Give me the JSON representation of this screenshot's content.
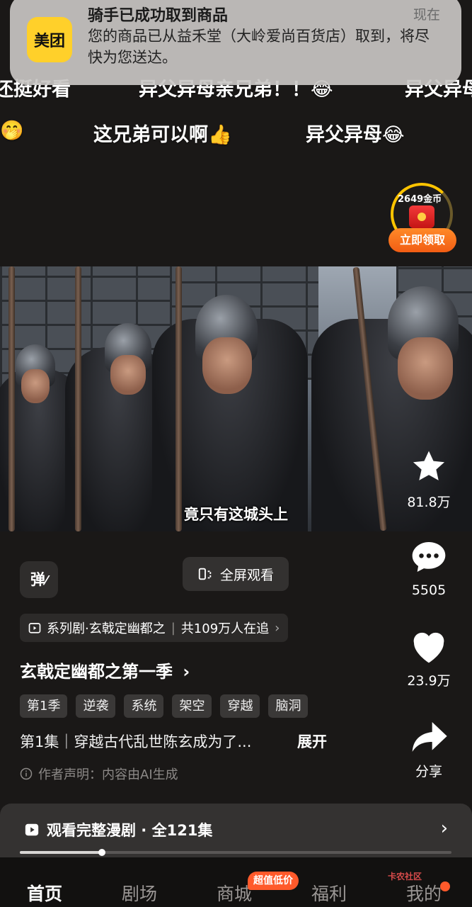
{
  "notification": {
    "app_name": "美团",
    "title": "骑手已成功取到商品",
    "time": "现在",
    "body": "您的商品已从益禾堂（大岭爱尚百货店）取到，将尽快为您送达。"
  },
  "danmaku": {
    "row1": [
      "还挺好看",
      "异父异母亲兄弟！！😂",
      "异父异母"
    ],
    "row2": [
      "🤭",
      "这兄弟可以啊👍",
      "异父异母😂"
    ]
  },
  "coin_widget": {
    "amount": "2649金币",
    "claim_label": "立即领取"
  },
  "video": {
    "subtitle": "竟只有这城头上"
  },
  "actions": {
    "favorite_count": "81.8万",
    "comment_count": "5505",
    "like_count": "23.9万",
    "share_label": "分享"
  },
  "controls": {
    "danmu_label": "弹",
    "fullscreen_label": "全屏观看"
  },
  "series": {
    "name": "系列剧·玄戟定幽都之",
    "followers": "共109万人在追"
  },
  "drama": {
    "title": "玄戟定幽都之第一季",
    "tags": [
      "第1季",
      "逆袭",
      "系统",
      "架空",
      "穿越",
      "脑洞"
    ],
    "episode_desc": "第1集｜穿越古代乱世陈玄成为了...",
    "expand_label": "展开",
    "disclaimer": "作者声明：内容由AI生成"
  },
  "watch_bar": {
    "label": "观看完整漫剧 · 全121集",
    "progress": 0.19
  },
  "nav": {
    "items": [
      "首页",
      "剧场",
      "商城",
      "福利",
      "我的"
    ],
    "active": "首页",
    "badge": "超值低价"
  },
  "watermark": "卡农社区",
  "colors": {
    "accent_orange": "#ff5a2b",
    "coin_gold": "#ffc400",
    "meituan_yellow": "#ffd02a"
  }
}
